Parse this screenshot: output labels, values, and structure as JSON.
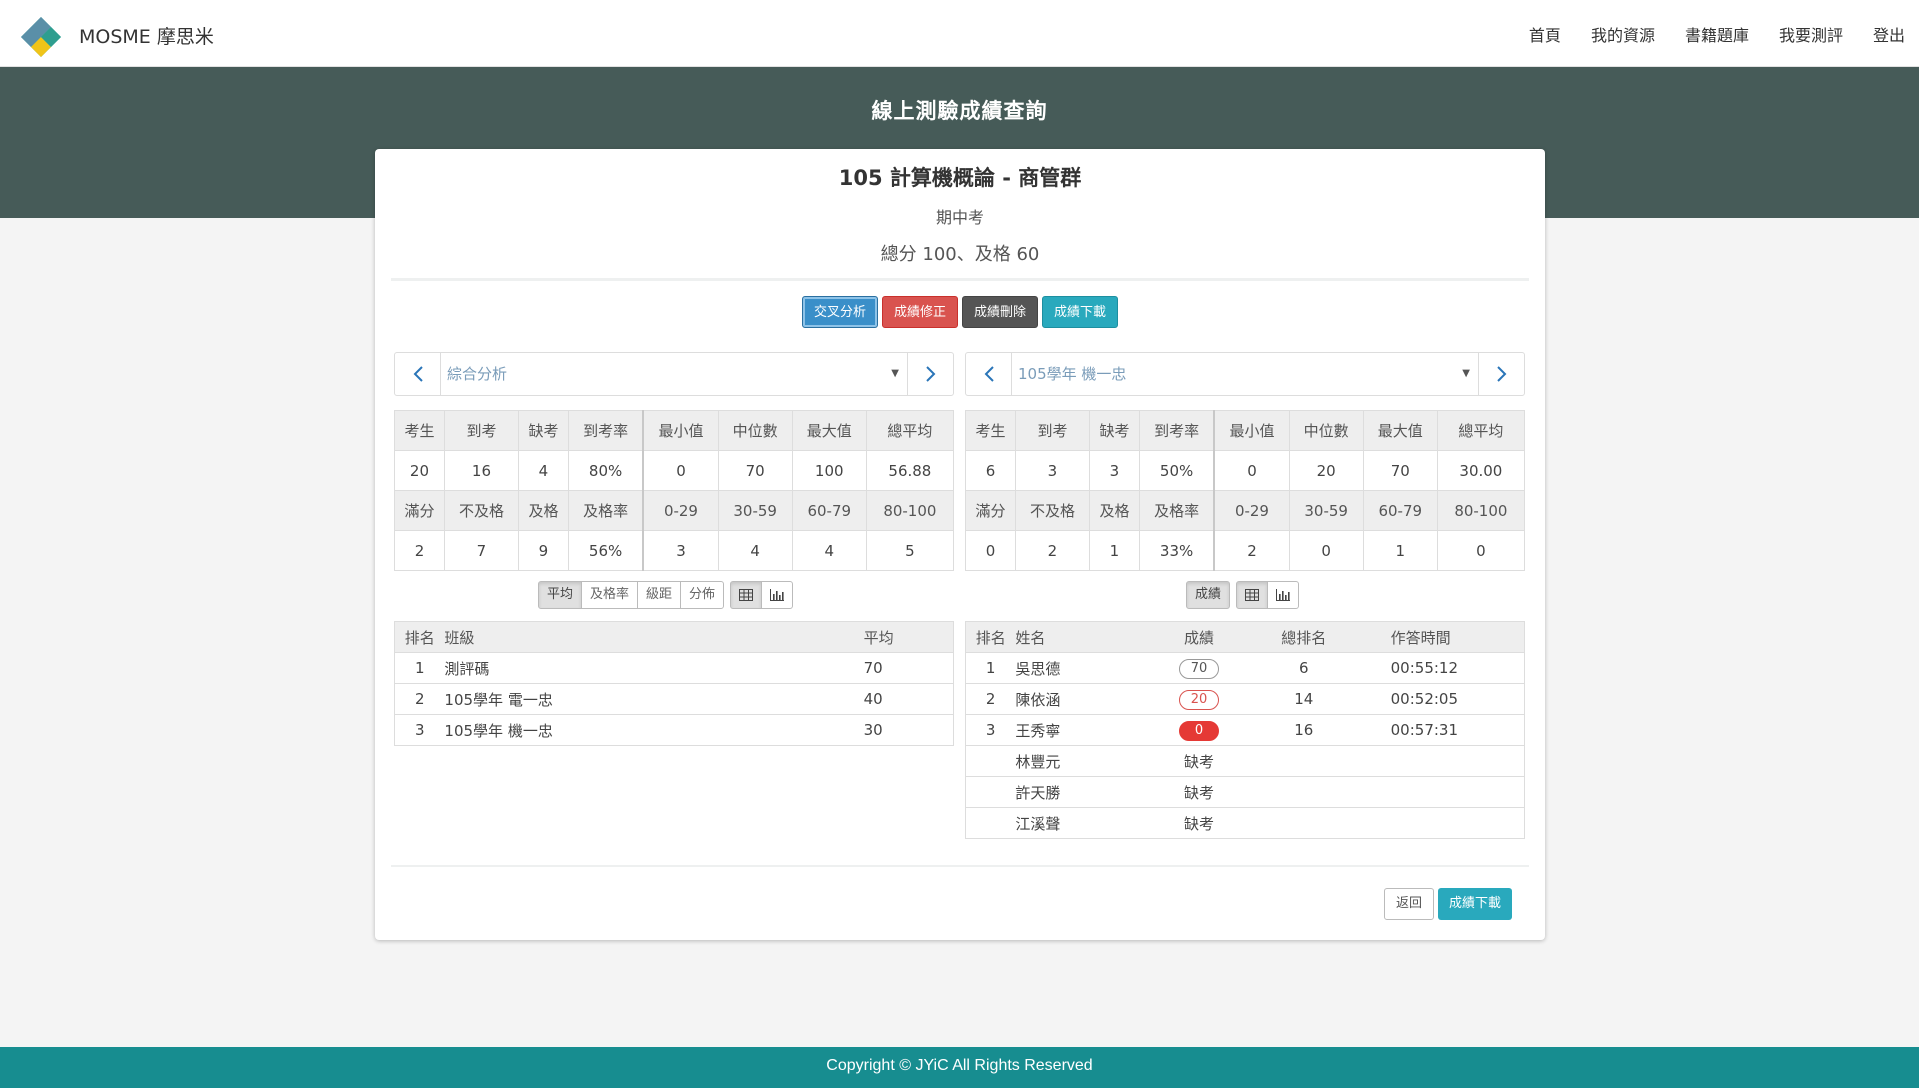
{
  "brand": {
    "name": "MOSME 摩思米"
  },
  "nav": {
    "items": [
      "首頁",
      "我的資源",
      "書籍題庫",
      "我要測評",
      "登出"
    ]
  },
  "banner": {
    "title": "線上測驗成績查詢"
  },
  "exam": {
    "course": "105 計算機概論 - 商管群",
    "name": "期中考",
    "score_info": "總分 100、及格 60"
  },
  "actions": {
    "cross": "交叉分析",
    "correct": "成績修正",
    "delete": "成績刪除",
    "download": "成績下載"
  },
  "left": {
    "selector": "綜合分析",
    "stats": {
      "h1": [
        "考生",
        "到考",
        "缺考",
        "到考率",
        "最小值",
        "中位數",
        "最大值",
        "總平均"
      ],
      "v1": [
        "20",
        "16",
        "4",
        "80%",
        "0",
        "70",
        "100",
        "56.88"
      ],
      "h2": [
        "滿分",
        "不及格",
        "及格",
        "及格率",
        "0-29",
        "30-59",
        "60-79",
        "80-100"
      ],
      "v2": [
        "2",
        "7",
        "9",
        "56%",
        "3",
        "4",
        "4",
        "5"
      ]
    },
    "toggles": [
      "平均",
      "及格率",
      "級距",
      "分佈"
    ],
    "table": {
      "headers": [
        "排名",
        "班級",
        "平均"
      ],
      "rows": [
        {
          "rank": "1",
          "class": "測評碼",
          "avg": "70"
        },
        {
          "rank": "2",
          "class": "105學年 電一忠",
          "avg": "40"
        },
        {
          "rank": "3",
          "class": "105學年 機一忠",
          "avg": "30"
        }
      ]
    }
  },
  "right": {
    "selector": "105學年 機一忠",
    "stats": {
      "h1": [
        "考生",
        "到考",
        "缺考",
        "到考率",
        "最小值",
        "中位數",
        "最大值",
        "總平均"
      ],
      "v1": [
        "6",
        "3",
        "3",
        "50%",
        "0",
        "20",
        "70",
        "30.00"
      ],
      "h2": [
        "滿分",
        "不及格",
        "及格",
        "及格率",
        "0-29",
        "30-59",
        "60-79",
        "80-100"
      ],
      "v2": [
        "0",
        "2",
        "1",
        "33%",
        "2",
        "0",
        "1",
        "0"
      ]
    },
    "toggles": [
      "成績"
    ],
    "table": {
      "headers": [
        "排名",
        "姓名",
        "成績",
        "總排名",
        "作答時間"
      ],
      "rows": [
        {
          "rank": "1",
          "name": "吳思德",
          "score": "70",
          "overall": "6",
          "time": "00:55:12"
        },
        {
          "rank": "2",
          "name": "陳依涵",
          "score": "20",
          "overall": "14",
          "time": "00:52:05"
        },
        {
          "rank": "3",
          "name": "王秀寧",
          "score": "0",
          "overall": "16",
          "time": "00:57:31"
        },
        {
          "rank": "",
          "name": "林豐元",
          "score": "缺考",
          "overall": "",
          "time": ""
        },
        {
          "rank": "",
          "name": "許天勝",
          "score": "缺考",
          "overall": "",
          "time": ""
        },
        {
          "rank": "",
          "name": "江溪聲",
          "score": "缺考",
          "overall": "",
          "time": ""
        }
      ]
    }
  },
  "bottom": {
    "back": "返回",
    "download": "成績下載"
  },
  "footer": {
    "text": "Copyright © JYiC All Rights Reserved"
  },
  "colors": {
    "banner": "#465b58",
    "footer": "#178d90",
    "accent": "#29a9bd",
    "danger": "#d9534f"
  }
}
